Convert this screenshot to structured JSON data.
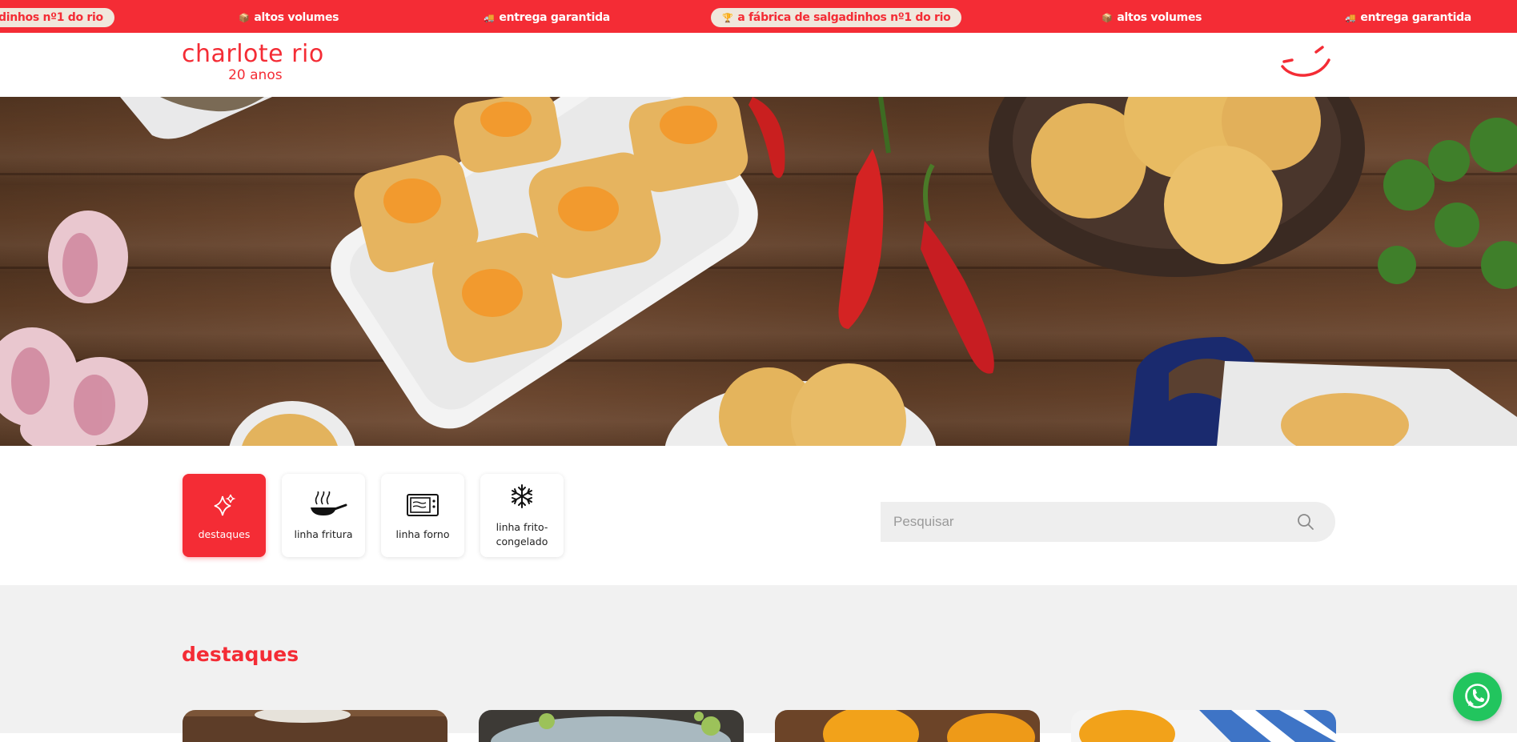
{
  "ticker": {
    "items": [
      {
        "text": "dinhos nº1 do rio",
        "emoji": "",
        "pill": true
      },
      {
        "text": "altos volumes",
        "emoji": "📦",
        "pill": false
      },
      {
        "text": "entrega garantida",
        "emoji": "🚚",
        "pill": false
      },
      {
        "text": "a fábrica de salgadinhos nº1 do rio",
        "emoji": "🏆",
        "pill": true
      },
      {
        "text": "altos volumes",
        "emoji": "📦",
        "pill": false
      },
      {
        "text": "entrega garantida",
        "emoji": "🚚",
        "pill": false
      }
    ]
  },
  "header": {
    "brand_name": "charlote rio",
    "brand_sub": "20 anos"
  },
  "categories": [
    {
      "label": "destaques",
      "icon": "sparkles-icon",
      "active": true
    },
    {
      "label": "linha fritura",
      "icon": "frying-pan-icon",
      "active": false
    },
    {
      "label": "linha forno",
      "icon": "oven-icon",
      "active": false
    },
    {
      "label": "linha frito-congelado",
      "icon": "snowflake-icon",
      "active": false
    }
  ],
  "search": {
    "placeholder": "Pesquisar",
    "value": ""
  },
  "section": {
    "title": "destaques"
  },
  "colors": {
    "brand_red": "#f42c35",
    "pill_bg": "#f0e7dc",
    "section_bg": "#f1f1f1",
    "whatsapp_green": "#22c55e"
  }
}
